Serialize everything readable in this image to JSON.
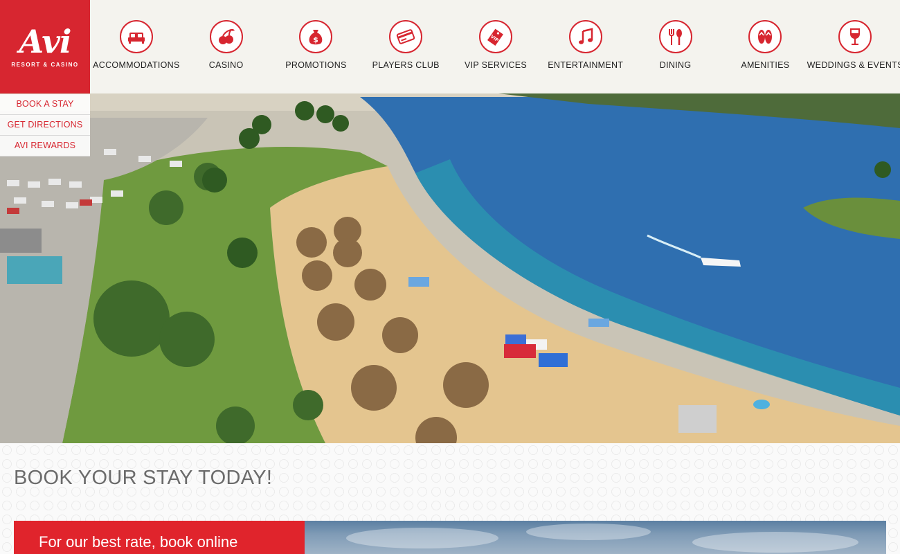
{
  "brand": {
    "name": "Avi",
    "tagline": "RESORT & CASINO",
    "color": "#d72630"
  },
  "nav": {
    "items": [
      {
        "label": "ACCOMMODATIONS",
        "icon": "bed-icon"
      },
      {
        "label": "CASINO",
        "icon": "cherries-icon"
      },
      {
        "label": "PROMOTIONS",
        "icon": "money-bag-icon"
      },
      {
        "label": "PLAYERS CLUB",
        "icon": "card-icon"
      },
      {
        "label": "VIP SERVICES",
        "icon": "vip-tag-icon"
      },
      {
        "label": "ENTERTAINMENT",
        "icon": "music-note-icon"
      },
      {
        "label": "DINING",
        "icon": "utensils-icon"
      },
      {
        "label": "AMENITIES",
        "icon": "flip-flops-icon"
      },
      {
        "label": "WEDDINGS & EVENTS",
        "icon": "wine-glass-icon"
      }
    ]
  },
  "quick_links": [
    {
      "label": "BOOK A STAY"
    },
    {
      "label": "GET DIRECTIONS"
    },
    {
      "label": "AVI REWARDS"
    }
  ],
  "book": {
    "title": "BOOK YOUR STAY TODAY!",
    "promo_text": "For our best rate, book online"
  }
}
